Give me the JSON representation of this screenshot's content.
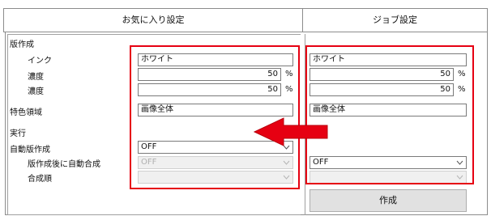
{
  "header": {
    "favorites_title": "お気に入り設定",
    "job_title": "ジョブ設定"
  },
  "labels": {
    "plate_making": "版作成",
    "ink": "インク",
    "density1": "濃度",
    "density2": "濃度",
    "spot_region": "特色領域",
    "execute": "実行",
    "auto_plate": "自動版作成",
    "auto_compose": "版作成後に自動合成",
    "compose_order": "合成順"
  },
  "favorites": {
    "ink_value": "ホワイト",
    "density1_value": "50",
    "density2_value": "50",
    "unit": "%",
    "spot_region_value": "画像全体",
    "auto_plate_value": "OFF",
    "auto_compose_value": "OFF",
    "compose_order_value": ""
  },
  "job": {
    "ink_value": "ホワイト",
    "density1_value": "50",
    "density2_value": "50",
    "unit": "%",
    "spot_region_value": "画像全体",
    "auto_compose_value": "OFF",
    "compose_order_value": "",
    "create_button": "作成"
  },
  "annotation": {
    "highlight_color": "#e60012",
    "arrow_color": "#e60012"
  }
}
